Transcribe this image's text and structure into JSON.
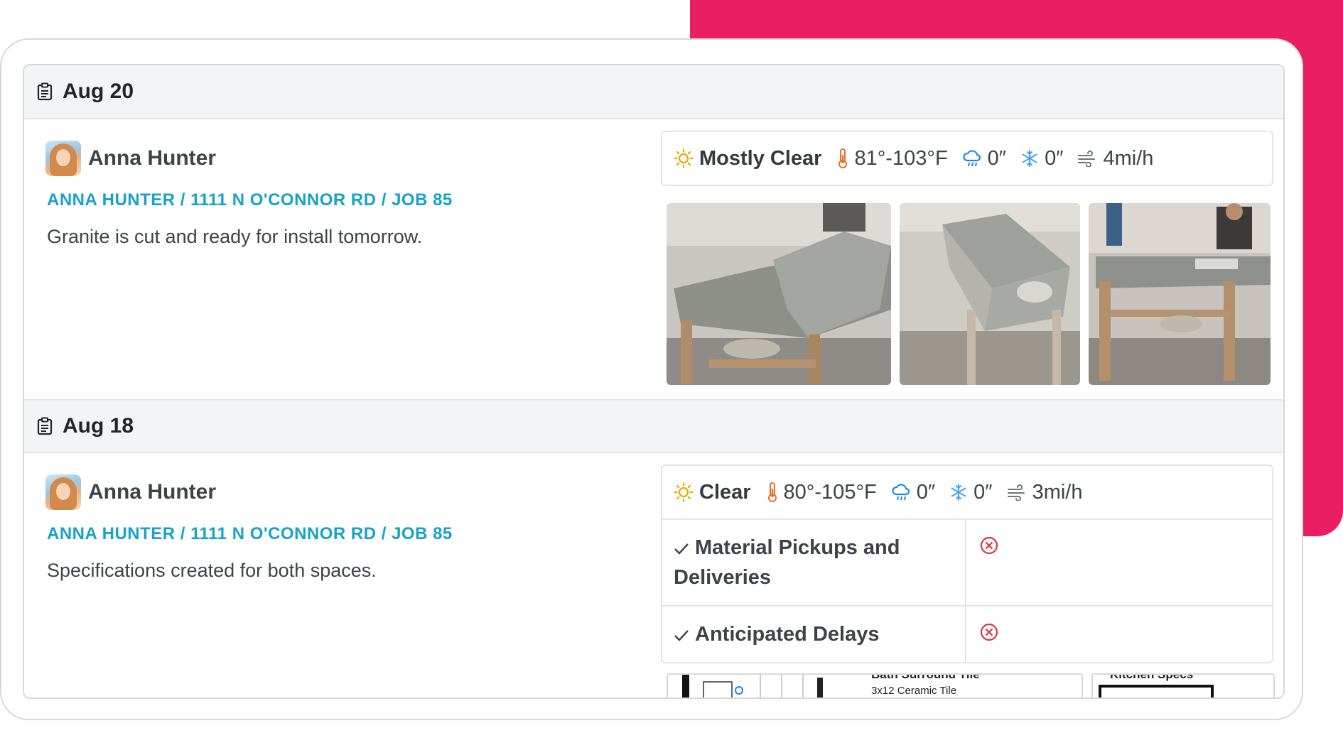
{
  "colors": {
    "accent_pink": "#e91e63",
    "link": "#17a2c8",
    "error": "#dc3545",
    "sun": "#f0a500",
    "thermometer": "#e8702a",
    "rain": "#1e88e5",
    "snow": "#42a5f5"
  },
  "days": [
    {
      "date": "Aug 20",
      "author": "Anna Hunter",
      "job": "ANNA HUNTER / 1111 N O'CONNOR RD / JOB 85",
      "note": "Granite is cut and ready for install tomorrow.",
      "weather": {
        "condition": "Mostly Clear",
        "temp": "81°-103°F",
        "rain": "0″",
        "snow": "0″",
        "wind": "4mi/h"
      }
    },
    {
      "date": "Aug 18",
      "author": "Anna Hunter",
      "job": "ANNA HUNTER / 1111 N O'CONNOR RD / JOB 85",
      "note": "Specifications created for both spaces.",
      "weather": {
        "condition": "Clear",
        "temp": "80°-105°F",
        "rain": "0″",
        "snow": "0″",
        "wind": "3mi/h"
      },
      "checklist": [
        {
          "label": "Material Pickups and Deliveries"
        },
        {
          "label": "Anticipated Delays"
        }
      ],
      "attachments": {
        "bath_title": "Bath Surround Tile",
        "bath_sub": "3x12 Ceramic Tile",
        "kitchen_title": "Kitchen Specs"
      }
    }
  ]
}
